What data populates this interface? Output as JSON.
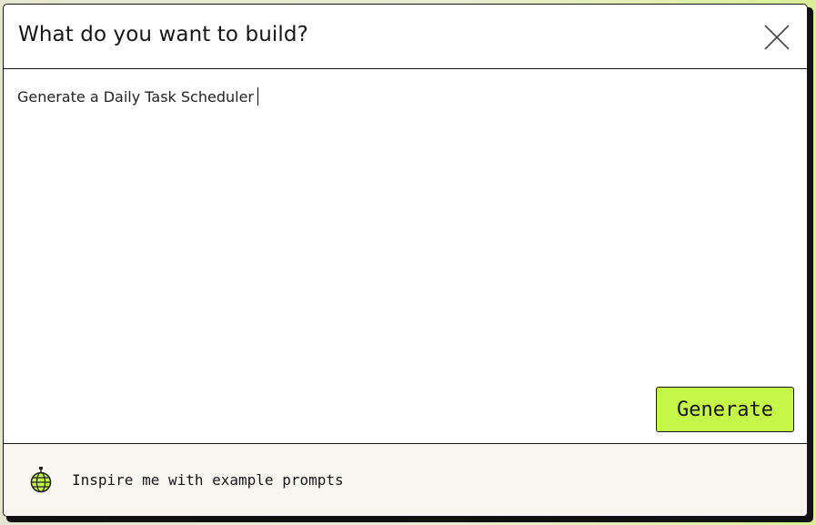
{
  "dialog": {
    "title": "What do you want to build?",
    "close_icon": "close-icon"
  },
  "editor": {
    "prompt_value": "Generate a Daily Task Scheduler"
  },
  "actions": {
    "generate_label": "Generate",
    "generate_color": "#c4f74a"
  },
  "footer": {
    "inspire_label": "Inspire me with example prompts",
    "inspire_icon": "disco-globe-icon"
  }
}
